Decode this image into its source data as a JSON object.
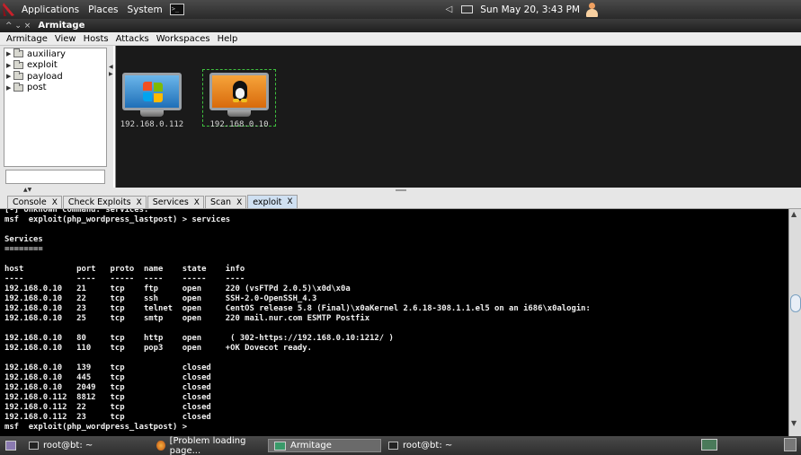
{
  "top_panel": {
    "menus": [
      "Applications",
      "Places",
      "System"
    ],
    "clock": "Sun May 20,  3:43 PM",
    "icons": [
      "backtrack-logo-icon",
      "terminal-launcher-icon",
      "speaker-icon",
      "mail-icon",
      "user-icon"
    ]
  },
  "window": {
    "controls": "^  ⌄  ×",
    "title": "Armitage"
  },
  "menubar": {
    "items": [
      "Armitage",
      "View",
      "Hosts",
      "Attacks",
      "Workspaces",
      "Help"
    ]
  },
  "module_tree": {
    "items": [
      "auxiliary",
      "exploit",
      "payload",
      "post"
    ]
  },
  "hosts": [
    {
      "ip": "192.168.0.112",
      "os": "windows"
    },
    {
      "ip": "192.168.0.10",
      "os": "linux"
    }
  ],
  "tabs": [
    {
      "label": "Console",
      "close": "X",
      "active": false
    },
    {
      "label": "Check Exploits",
      "close": "X",
      "active": false
    },
    {
      "label": "Services",
      "close": "X",
      "active": false
    },
    {
      "label": "Scan",
      "close": "X",
      "active": false
    },
    {
      "label": "exploit",
      "close": "X",
      "active": true
    }
  ],
  "console": {
    "lines": [
      "[-] Unknown command: services.",
      "msf  exploit(php_wordpress_lastpost) > services",
      "",
      "Services",
      "========",
      "",
      "host           port   proto  name    state    info",
      "----           ----   -----  ----    -----    ----",
      "192.168.0.10   21     tcp    ftp     open     220 (vsFTPd 2.0.5)\\x0d\\x0a",
      "192.168.0.10   22     tcp    ssh     open     SSH-2.0-OpenSSH_4.3",
      "192.168.0.10   23     tcp    telnet  open     CentOS release 5.8 (Final)\\x0aKernel 2.6.18-308.1.1.el5 on an i686\\x0alogin:",
      "192.168.0.10   25     tcp    smtp    open     220 mail.nur.com ESMTP Postfix",
      "",
      "192.168.0.10   80     tcp    http    open      ( 302-https://192.168.0.10:1212/ )",
      "192.168.0.10   110    tcp    pop3    open     +OK Dovecot ready.",
      "",
      "192.168.0.10   139    tcp            closed",
      "192.168.0.10   445    tcp            closed",
      "192.168.0.10   2049   tcp            closed",
      "192.168.0.112  8812   tcp            closed",
      "192.168.0.112  22     tcp            closed",
      "192.168.0.112  23     tcp            closed",
      "msf  exploit(php_wordpress_lastpost) >"
    ]
  },
  "taskbar": {
    "tasks": [
      {
        "label": "root@bt: ~",
        "kind": "terminal",
        "active": false
      },
      {
        "label": "[Problem loading page...",
        "kind": "firefox",
        "active": false
      },
      {
        "label": "Armitage",
        "kind": "armitage",
        "active": true
      },
      {
        "label": "root@bt: ~",
        "kind": "terminal",
        "active": false
      }
    ]
  }
}
